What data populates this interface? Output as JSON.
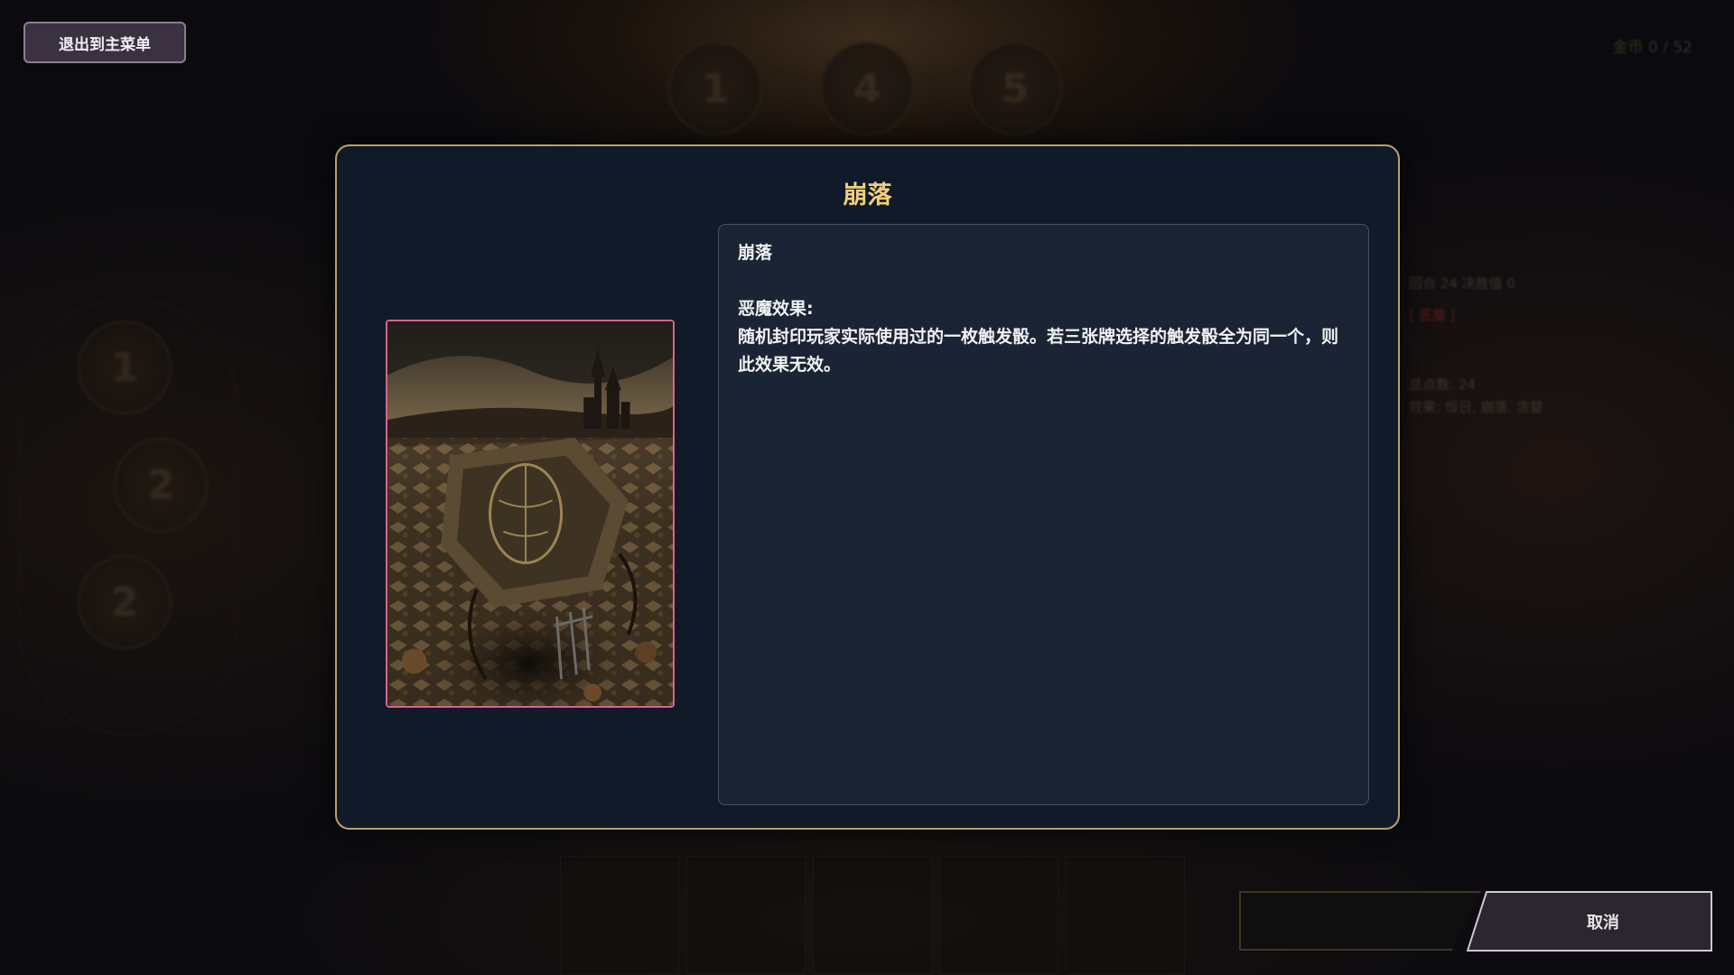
{
  "topbar": {
    "exit_label": "退出到主菜单",
    "gold_readout": "金币 0 / 52"
  },
  "background": {
    "top_dice": [
      "1",
      "4",
      "5"
    ],
    "left_dice": [
      "1",
      "2",
      "2"
    ],
    "right_panel_lines": [
      "回合 24   决胜值 0",
      "[ 恶魔 ]",
      "总点数: 24",
      "效果: 恒日, 崩落, 贪婪"
    ]
  },
  "modal": {
    "title": "崩落",
    "card_name": "崩落",
    "effect_heading": "恶魔效果:",
    "effect_text": "随机封印玩家实际使用过的一枚触发骰。若三张牌选择的触发骰全为同一个，则此效果无效。"
  },
  "actions": {
    "cancel_label": "取消"
  },
  "colors": {
    "title_gold": "#f0cf7a",
    "modal_border": "#b8a06a",
    "card_frame": "#d8648a"
  }
}
